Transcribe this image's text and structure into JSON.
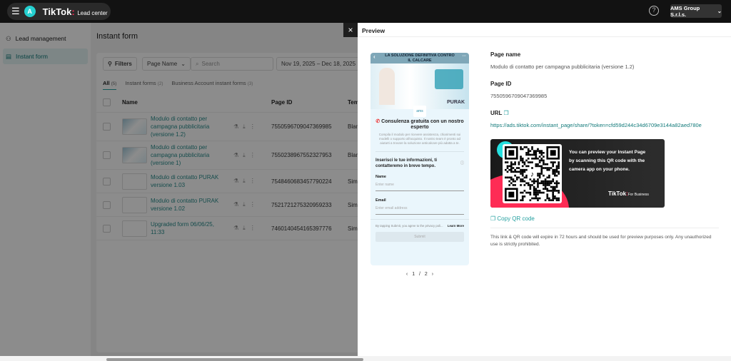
{
  "topbar": {
    "brand": "TikTok",
    "product": "Lead center",
    "avatar_letter": "A",
    "account": "AMS Group S.r.l.s.",
    "help_icon": "question-circle-icon"
  },
  "sidebar": {
    "items": [
      {
        "label": "Lead management",
        "icon": "user-icon"
      },
      {
        "label": "Instant form",
        "icon": "document-icon",
        "active": true
      }
    ]
  },
  "main": {
    "title": "Instant form",
    "filters_label": "Filters",
    "page_name_select": "Page Name",
    "search_placeholder": "Search",
    "date_range": "Nov 19, 2025 – Dec 18, 2025",
    "tabs": [
      {
        "label": "All",
        "count": "(5)"
      },
      {
        "label": "Instant forms",
        "count": "(2)"
      },
      {
        "label": "Business Account instant forms",
        "count": "(3)"
      }
    ],
    "columns": [
      "Name",
      "Page ID",
      "Tem"
    ],
    "rows": [
      {
        "name": "Modulo di contatto per campagna pubblicitaria (versione 1.2)",
        "page_id": "7550596709047369985",
        "template": "Blan"
      },
      {
        "name": "Modulo di contatto per campagna pubblicitaria (versione 1)",
        "page_id": "7550238967552327953",
        "template": "Blan"
      },
      {
        "name": "Modulo di contatto PURAK versione 1.03",
        "page_id": "7548460683457790224",
        "template": "Sim"
      },
      {
        "name": "Modulo di contatto PURAK versione 1.02",
        "page_id": "7521721275320959233",
        "template": "Sim"
      },
      {
        "name": "Upgraded form 06/06/25, 11:33",
        "page_id": "7460140454165397776",
        "template": "Sim"
      }
    ]
  },
  "drawer": {
    "title": "Preview",
    "close": "×",
    "phone": {
      "banner_title": "LA SOLUZIONE DEFINITIVA CONTRO IL CALCARE",
      "brand": "PURAK",
      "logo": "ams",
      "heading": "Consulenza gratuita con un nostro esperto",
      "description": "Compila il modulo per ricevere assistenza, chiarimenti sui modelli o supporto all'acquisto. Il nostro team è pronto ad aiutarti a trovare la soluzione anticalcare più adatta a te.",
      "form_title": "Inserisci le tue informazioni, ti contatteremo in breve tempo.",
      "name_label": "Name",
      "name_placeholder": "Enter name",
      "email_label": "Email",
      "email_placeholder": "Enter email address",
      "consent": "By tapping Submit, you agree to the privacy poli...",
      "learn_more": "Learn More",
      "submit": "Submit"
    },
    "pager": "1 / 2",
    "page_name_label": "Page name",
    "page_name": "Modulo di contatto per campagna pubblicitaria (versione 1.2)",
    "page_id_label": "Page ID",
    "page_id": "7550596709047369985",
    "url_label": "URL",
    "url": "https://ads.tiktok.com/instant_page/share/?token=cfd59d244c34d6709e3144a82aed780e",
    "qr_text": "You can preview your Instant Page by scanning this QR code with the camera app on your phone.",
    "qr_brand": "TikTok",
    "qr_brand_sub": "For Business",
    "copy_qr": "Copy QR code",
    "note": "This link & QR code will expire in 72 hours and should be used for preview purposes only. Any unauthorized use is strictly prohibited."
  },
  "colors": {
    "accent": "#25a0a0",
    "tiktok_cyan": "#25e0e0",
    "tiktok_red": "#fe2c55"
  }
}
